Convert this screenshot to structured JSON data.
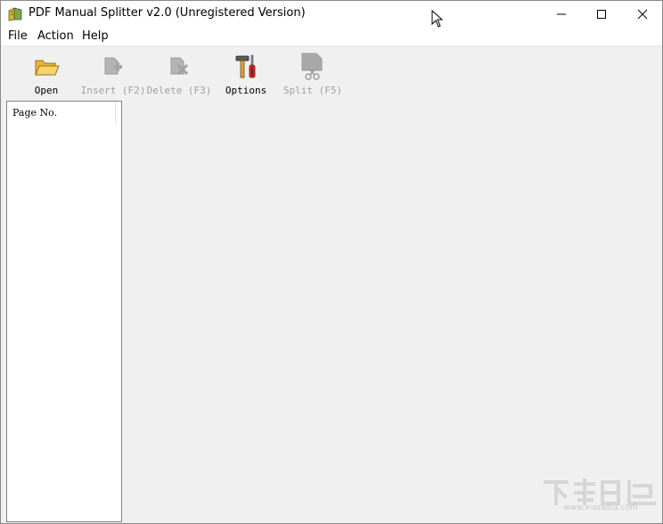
{
  "window": {
    "title": "PDF Manual Splitter v2.0 (Unregistered Version)"
  },
  "menubar": {
    "items": [
      {
        "label": "File"
      },
      {
        "label": "Action"
      },
      {
        "label": "Help"
      }
    ]
  },
  "toolbar": {
    "buttons": [
      {
        "label": "Open",
        "icon": "folder-open-icon",
        "enabled": true
      },
      {
        "label": "Insert (F2)",
        "icon": "insert-page-icon",
        "enabled": false
      },
      {
        "label": "Delete (F3)",
        "icon": "delete-page-icon",
        "enabled": false
      },
      {
        "label": "Options",
        "icon": "tools-icon",
        "enabled": true
      },
      {
        "label": "Split (F5)",
        "icon": "split-scissors-icon",
        "enabled": false
      }
    ]
  },
  "page_list": {
    "column_header": "Page No."
  },
  "watermark": {
    "text": "www.xiazaiba.com"
  },
  "colors": {
    "window_bg": "#f0f0f0",
    "titlebar_bg": "#ffffff",
    "disabled_text": "#a0a0a0",
    "folder_yellow": "#f5c94a"
  }
}
